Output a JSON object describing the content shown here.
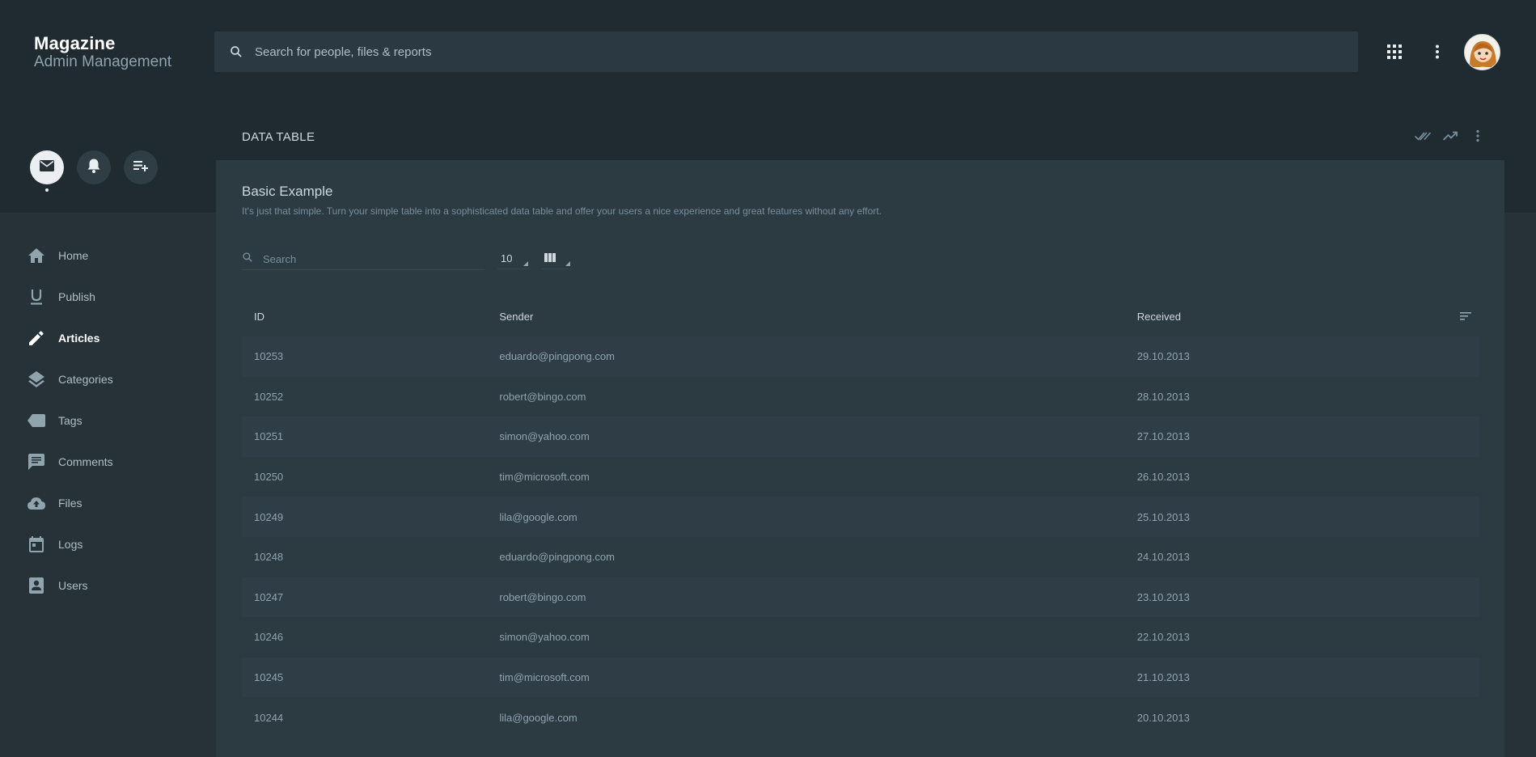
{
  "header": {
    "brand_title": "Magazine",
    "brand_subtitle": "Admin Management",
    "search_placeholder": "Search for people, files & reports"
  },
  "sidebar": {
    "actions": [
      {
        "icon": "mail-icon",
        "active": true
      },
      {
        "icon": "bell-icon",
        "active": false
      },
      {
        "icon": "playlist-add-icon",
        "active": false
      }
    ],
    "items": [
      {
        "label": "Home",
        "icon": "home-icon"
      },
      {
        "label": "Publish",
        "icon": "underline-icon"
      },
      {
        "label": "Articles",
        "icon": "pencil-icon",
        "active": true
      },
      {
        "label": "Categories",
        "icon": "layers-icon"
      },
      {
        "label": "Tags",
        "icon": "tag-icon"
      },
      {
        "label": "Comments",
        "icon": "comment-icon"
      },
      {
        "label": "Files",
        "icon": "cloud-upload-icon"
      },
      {
        "label": "Logs",
        "icon": "calendar-icon"
      },
      {
        "label": "Users",
        "icon": "account-box-icon"
      }
    ]
  },
  "card": {
    "title": "DATA TABLE",
    "example_title": "Basic Example",
    "example_desc": "It's just that simple. Turn your simple table into a sophisticated data table and offer your users a nice experience and great features without any effort.",
    "search_placeholder": "Search",
    "page_size": "10"
  },
  "table": {
    "columns": [
      "ID",
      "Sender",
      "Received"
    ],
    "rows": [
      [
        "10253",
        "eduardo@pingpong.com",
        "29.10.2013"
      ],
      [
        "10252",
        "robert@bingo.com",
        "28.10.2013"
      ],
      [
        "10251",
        "simon@yahoo.com",
        "27.10.2013"
      ],
      [
        "10250",
        "tim@microsoft.com",
        "26.10.2013"
      ],
      [
        "10249",
        "lila@google.com",
        "25.10.2013"
      ],
      [
        "10248",
        "eduardo@pingpong.com",
        "24.10.2013"
      ],
      [
        "10247",
        "robert@bingo.com",
        "23.10.2013"
      ],
      [
        "10246",
        "simon@yahoo.com",
        "22.10.2013"
      ],
      [
        "10245",
        "tim@microsoft.com",
        "21.10.2013"
      ],
      [
        "10244",
        "lila@google.com",
        "20.10.2013"
      ]
    ]
  },
  "colors": {
    "background": "#263238",
    "header_band": "#1f2a31",
    "card": "#2c3a42",
    "stripe": "#2f3e46"
  }
}
